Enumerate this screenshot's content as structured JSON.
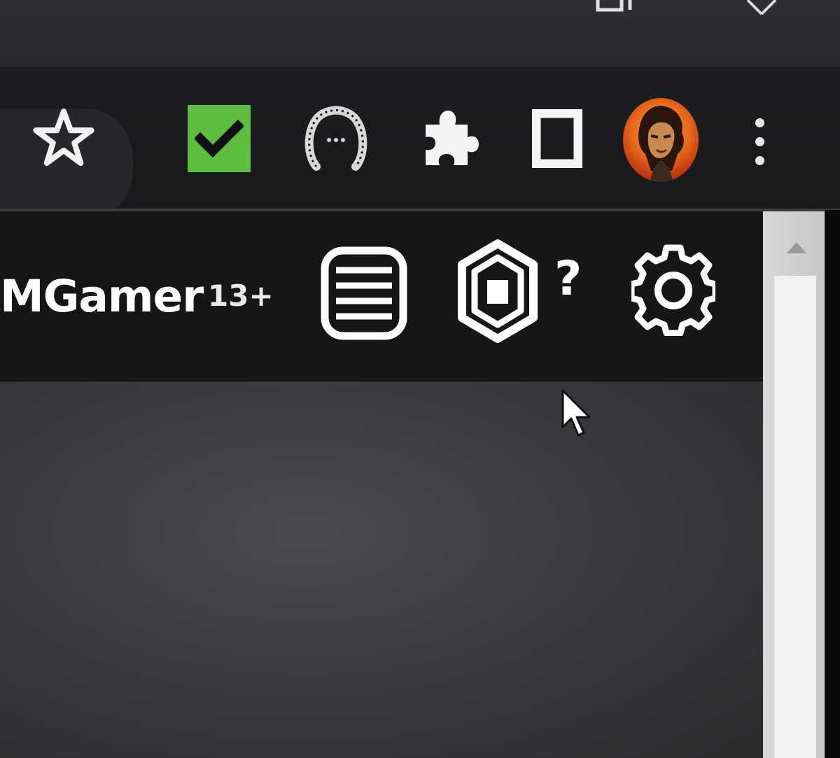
{
  "window": {
    "controls": [
      {
        "name": "restore-window",
        "icon": "restore-icon"
      },
      {
        "name": "close-window",
        "icon": "close-icon"
      }
    ]
  },
  "browser_toolbar": {
    "bookmark": {
      "icon": "star-outline-icon"
    },
    "extensions": [
      {
        "name": "checkmark-extension",
        "icon": "green-checkmark-icon",
        "color": "#5dbd3f"
      },
      {
        "name": "horseshoe-extension",
        "icon": "horseshoe-icon"
      },
      {
        "name": "extensions-menu",
        "icon": "puzzle-piece-icon"
      },
      {
        "name": "frame-extension",
        "icon": "frame-icon"
      }
    ],
    "profile": {
      "icon": "profile-avatar"
    },
    "menu": {
      "icon": "vertical-dots-icon"
    }
  },
  "site_header": {
    "username": "MGamer",
    "age_rating": "13+",
    "icons": [
      {
        "name": "menu",
        "icon": "list-menu-icon"
      },
      {
        "name": "robux",
        "icon": "robux-hexagon-icon"
      },
      {
        "name": "help",
        "icon": "question-mark-icon"
      },
      {
        "name": "settings",
        "icon": "gear-icon"
      }
    ],
    "help_text": "?"
  },
  "colors": {
    "toolbar_bg": "#1c1d20",
    "header_bg": "#151617",
    "content_bg": "#3a3b3e",
    "accent_green": "#5dbd3f",
    "avatar_orange": "#e86a1c",
    "scrollbar": "#d8d8d8"
  }
}
